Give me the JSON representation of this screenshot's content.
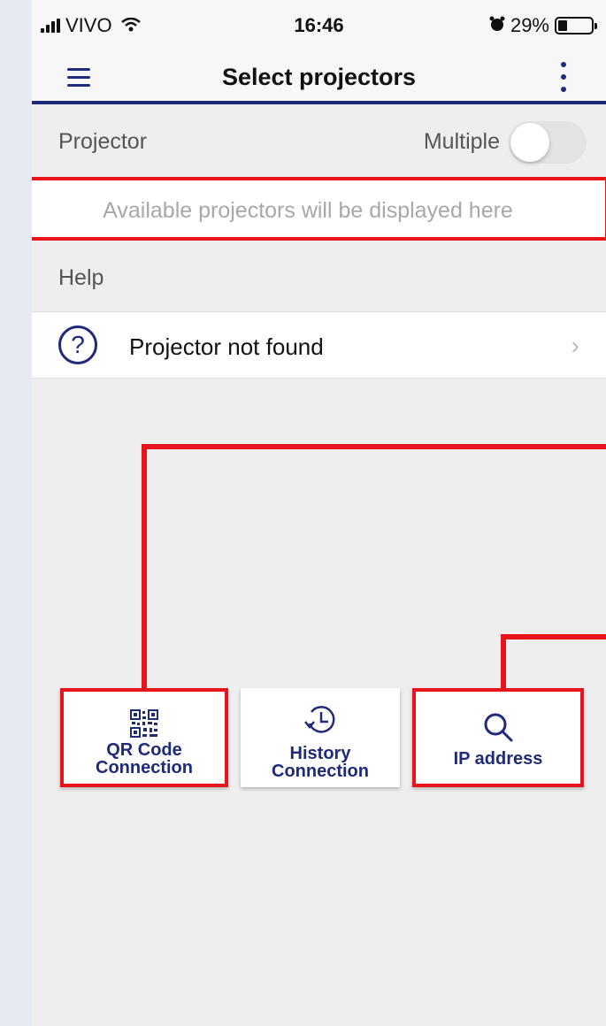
{
  "status_bar": {
    "carrier": "VIVO",
    "time": "16:46",
    "battery": "29%",
    "battery_level": 0.29
  },
  "nav": {
    "title": "Select projectors",
    "menu_icon": "hamburger-menu-icon",
    "more_icon": "vertical-dots-icon"
  },
  "projector_section": {
    "label": "Projector",
    "multiple_label": "Multiple",
    "multiple_enabled": false
  },
  "available": {
    "placeholder": "Available projectors will be displayed here"
  },
  "help": {
    "label": "Help",
    "item": "Projector not found",
    "item_icon": "question-circle-icon"
  },
  "buttons": [
    {
      "line1": "QR Code",
      "line2": "Connection",
      "icon": "qr-code-icon"
    },
    {
      "line1": "History",
      "line2": "Connection",
      "icon": "history-clock-icon"
    },
    {
      "line1": "IP address",
      "icon": "magnifier-icon"
    }
  ],
  "colors": {
    "accent": "#1f2a7a",
    "annotation": "#e8141b",
    "background": "#eeeeef"
  }
}
